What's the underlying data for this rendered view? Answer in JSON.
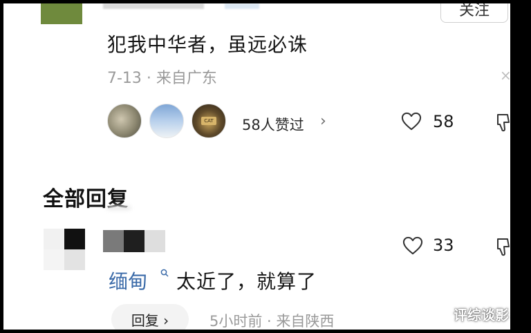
{
  "top": {
    "follow_label": "关注"
  },
  "comment": {
    "text": "犯我中华者，虽远必诛",
    "meta": "7-13 · 来自广东",
    "likers_label": "58人赞过",
    "likers_chevron": "›",
    "like_count": "58",
    "close_glyph": "×"
  },
  "section": {
    "title": "全部回复"
  },
  "reply": {
    "mention": "缅甸",
    "text": "太近了，就算了",
    "like_count": "33",
    "reply_label": "回复 ›",
    "meta": "5小时前 · 来自陕西"
  },
  "watermark": "评综谈影",
  "colors": {
    "mention": "#3a6aa8",
    "meta_gray": "#9a9a9a",
    "background": "#ffffff"
  },
  "icons": [
    "heart-icon",
    "dislike-icon",
    "chevron-right-icon",
    "search-icon",
    "close-icon"
  ]
}
